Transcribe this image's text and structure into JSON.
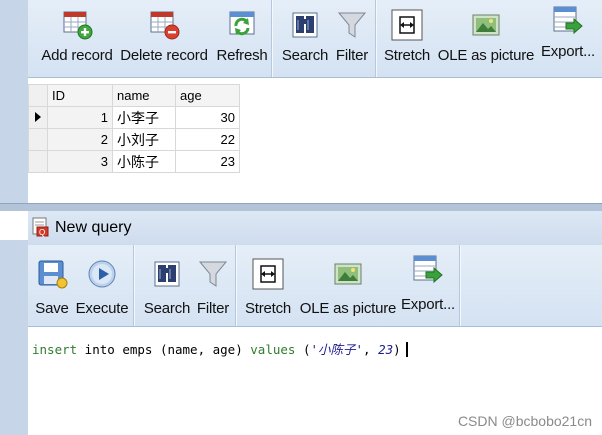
{
  "toolbar1": {
    "add_record": "Add record",
    "delete_record": "Delete record",
    "refresh": "Refresh",
    "search": "Search",
    "filter": "Filter",
    "stretch": "Stretch",
    "ole_as_picture": "OLE as picture",
    "export": "Export..."
  },
  "grid": {
    "columns": [
      "ID",
      "name",
      "age"
    ],
    "rows": [
      {
        "id": "1",
        "name": "小李子",
        "age": "30"
      },
      {
        "id": "2",
        "name": "小刘子",
        "age": "22"
      },
      {
        "id": "3",
        "name": "小陈子",
        "age": "23"
      }
    ]
  },
  "query_window": {
    "title": "New query"
  },
  "toolbar2": {
    "save": "Save",
    "execute": "Execute",
    "search": "Search",
    "filter": "Filter",
    "stretch": "Stretch",
    "ole_as_picture": "OLE as picture",
    "export": "Export..."
  },
  "editor": {
    "kw_insert": "insert",
    "t_into": " into ",
    "t_emps": "emps",
    "t_cols": " (name, age) ",
    "kw_values": "values",
    "t_open": " (",
    "str_val": "'小陈子'",
    "t_comma": ", ",
    "num_val": "23",
    "t_close": ")"
  },
  "watermark": "CSDN @bcbobo21cn",
  "colors": {
    "toolbar_bg": "#dce7f4",
    "keyword": "#2e7d2e",
    "literal": "#1b1b8f",
    "splitter": "#b3c4d8"
  }
}
